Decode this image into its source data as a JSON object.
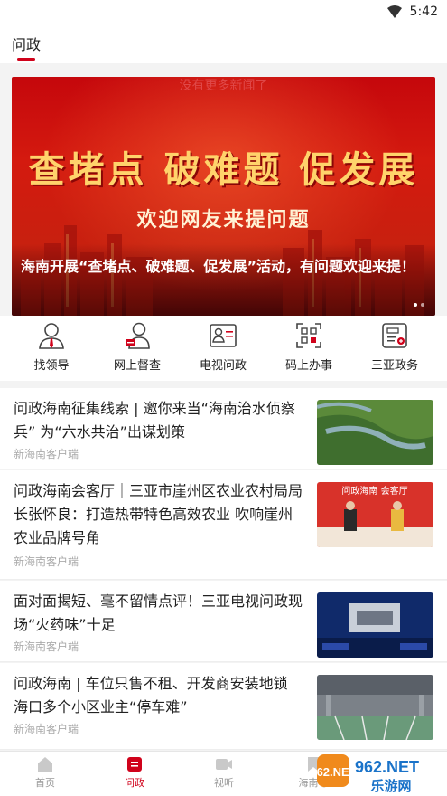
{
  "status_bar": {
    "time": "5:42"
  },
  "top_tabs": {
    "active": "问政"
  },
  "notice": "没有更多新闻了",
  "banner": {
    "headline": "查堵点 破难题 促发展",
    "slogan": "欢迎网友来提问题",
    "caption": "海南开展“查堵点、破难题、促发展”活动，有问题欢迎来提！"
  },
  "quick_links": [
    {
      "label": "找领导",
      "icon": "leader-icon"
    },
    {
      "label": "网上督查",
      "icon": "supervision-icon"
    },
    {
      "label": "电视问政",
      "icon": "tv-inquiry-icon"
    },
    {
      "label": "码上办事",
      "icon": "qr-service-icon"
    },
    {
      "label": "三亚政务",
      "icon": "sanya-gov-icon"
    }
  ],
  "news": [
    {
      "title": "问政海南征集线索 | 邀你来当“海南治水侦察兵” 为“六水共治”出谋划策",
      "source": "新海南客户端"
    },
    {
      "title": "问政海南会客厅｜三亚市崖州区农业农村局局长张怀良：打造热带特色高效农业 吹响崖州农业品牌号角",
      "source": "新海南客户端",
      "thumb_text": "问政海南 会客厅"
    },
    {
      "title": "面对面揭短、毫不留情点评！三亚电视问政现场“火药味”十足",
      "source": "新海南客户端"
    },
    {
      "title": "问政海南 | 车位只售不租、开发商安装地锁 海口多个小区业主“停车难”",
      "source": "新海南客户端"
    }
  ],
  "bottom_nav": [
    {
      "label": "首页",
      "icon": "home-icon"
    },
    {
      "label": "问政",
      "icon": "inquiry-icon",
      "active": true
    },
    {
      "label": "视听",
      "icon": "video-icon"
    },
    {
      "label": "海南号",
      "icon": "bookmark-icon"
    }
  ],
  "watermark": {
    "brand": "962.NET",
    "name": "乐游网"
  }
}
